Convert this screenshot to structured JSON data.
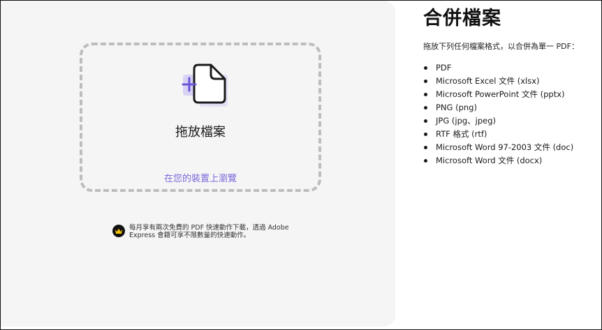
{
  "dropzone": {
    "title": "拖放檔案",
    "browse_link": "在您的裝置上瀏覽"
  },
  "notice": {
    "line1": "每月享有兩次免費的 PDF 快速動作下載，透過 Adobe",
    "line2": "Express 會籍可享不限數量的快速動作。"
  },
  "panel": {
    "title": "合併檔案",
    "description": "拖放下列任何檔案格式，以合併為單一 PDF：",
    "formats": [
      "PDF",
      "Microsoft Excel 文件 (xlsx)",
      "Microsoft PowerPoint 文件 (pptx)",
      "PNG (png)",
      "JPG (jpg、jpeg)",
      "RTF 格式 (rtf)",
      "Microsoft Word 97-2003 文件 (doc)",
      "Microsoft Word 文件 (docx)"
    ]
  },
  "colors": {
    "accent": "#7b68d9",
    "dash": "#bdbdbd",
    "panel_bg": "#f5f5f5"
  },
  "icons": [
    "add-file-icon",
    "crown-icon"
  ]
}
